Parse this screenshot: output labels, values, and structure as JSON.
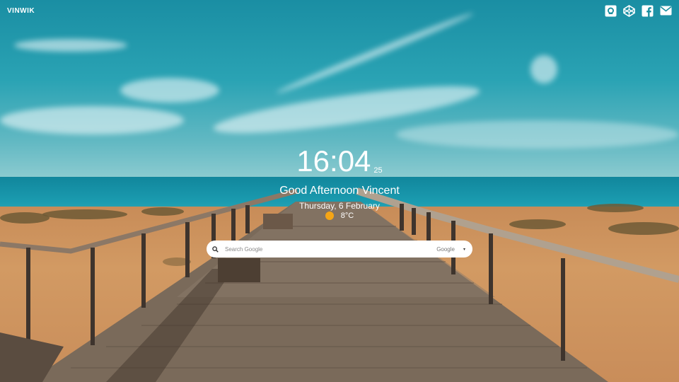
{
  "brand": "VINWIK",
  "social": [
    {
      "name": "github-icon"
    },
    {
      "name": "codepen-icon"
    },
    {
      "name": "facebook-icon"
    },
    {
      "name": "mail-icon"
    }
  ],
  "clock": {
    "time": "16:04",
    "seconds": "25"
  },
  "greeting": "Good Afternoon Vincent",
  "date": "Thursday, 6 February",
  "weather": {
    "temperature": "8°C",
    "icon": "sun-icon",
    "color": "#f5a515"
  },
  "search": {
    "placeholder": "Search Google",
    "engine": "Google",
    "caret": "▾"
  }
}
